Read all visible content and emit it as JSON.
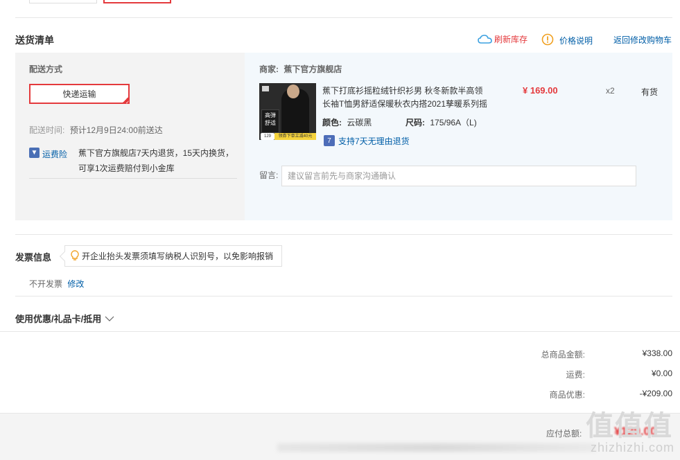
{
  "delivery": {
    "title": "送货清单",
    "refresh_stock": "刷新库存",
    "price_info": "价格说明",
    "back_to_cart": "返回修改购物车",
    "method_label": "配送方式",
    "method_value": "快递运输",
    "time_label": "配送时间:",
    "time_value": "预计12月9日24:00前送达",
    "insurance_label": "运费险",
    "insurance_text_line1": "蕉下官方旗舰店7天内退货，15天内换货，",
    "insurance_text_line2": "可享1次运费赔付到小金库",
    "merchant_label": "商家:",
    "merchant_name": "蕉下官方旗舰店"
  },
  "product": {
    "title_line1": "蕉下打底衫摇粒绒针织衫男 秋冬新款半高领",
    "title_line2": "长袖T恤男舒适保暖秋衣内搭2021孳暖系列摇",
    "price": "¥ 169.00",
    "quantity": "x2",
    "stock": "有货",
    "color_label": "颜色:",
    "color_value": "云碳黑",
    "size_label": "尺码:",
    "size_value": "175/96A（L)",
    "return_policy": "支持7天无理由退货",
    "image_tag_line1": "高弹",
    "image_tag_line2": "舒适",
    "image_banner": "领券下单立减40元",
    "image_price": "129"
  },
  "message": {
    "label": "留言:",
    "placeholder": "建议留言前先与商家沟通确认"
  },
  "invoice": {
    "title": "发票信息",
    "tip": "开企业抬头发票须填写纳税人识别号，以免影响报销",
    "status": "不开发票",
    "edit": "修改"
  },
  "coupon": {
    "title": "使用优惠/礼品卡/抵用"
  },
  "summary": {
    "total_label": "总商品金额:",
    "total_value": "¥338.00",
    "shipping_label": "运费:",
    "shipping_value": "¥0.00",
    "discount_label": "商品优惠:",
    "discount_value": "-¥209.00",
    "payable_label": "应付总额:",
    "payable_value": "¥129.00"
  },
  "watermark": {
    "main": "值值值",
    "sub": "zhizhizhi.com"
  },
  "colors": {
    "accent_red": "#e4393c",
    "link_blue": "#005ea7",
    "panel_grey": "#f3f3f3",
    "panel_blue": "#f3f8fc"
  },
  "icons": {
    "refresh": "cloud-refresh-icon",
    "price_info": "info-circle-icon",
    "insurance": "shield-icon",
    "return": "seven-day-return-icon",
    "tip": "lightbulb-icon",
    "coupon_toggle": "chevron-down-icon"
  }
}
